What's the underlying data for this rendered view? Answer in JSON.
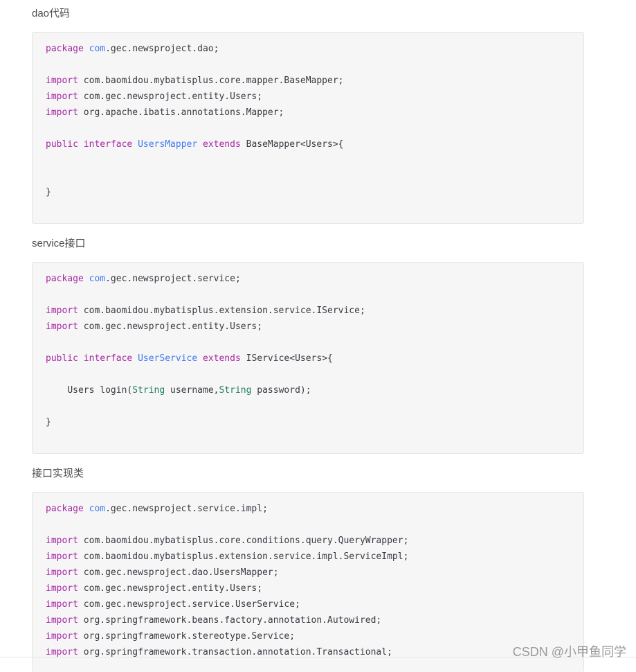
{
  "sections": [
    {
      "title": "dao代码",
      "code": {
        "line1": {
          "kw": "package",
          "pkg": "com",
          "rest": ".gec.newsproject.dao;"
        },
        "line2": {
          "kw": "import",
          "rest": "com.baomidou.mybatisplus.core.mapper.BaseMapper;"
        },
        "line3": {
          "kw": "import",
          "rest": "com.gec.newsproject.entity.Users;"
        },
        "line4": {
          "kw": "import",
          "rest": "org.apache.ibatis.annotations.Mapper;"
        },
        "line5": {
          "kw1": "public",
          "kw2": "interface",
          "name": "UsersMapper",
          "kw3": "extends",
          "rest": "BaseMapper<Users>{"
        },
        "line6": {
          "rest": "}"
        }
      }
    },
    {
      "title": "service接口",
      "code": {
        "line1": {
          "kw": "package",
          "pkg": "com",
          "rest": ".gec.newsproject.service;"
        },
        "line2": {
          "kw": "import",
          "rest": "com.baomidou.mybatisplus.extension.service.IService;"
        },
        "line3": {
          "kw": "import",
          "rest": "com.gec.newsproject.entity.Users;"
        },
        "line4": {
          "kw1": "public",
          "kw2": "interface",
          "name": "UserService",
          "kw3": "extends",
          "rest": "IService<Users>{"
        },
        "line5": {
          "a": "Users login(",
          "t1": "String",
          "b": " username,",
          "t2": "String",
          "c": " password);"
        },
        "line6": {
          "rest": "}"
        }
      }
    },
    {
      "title": "接口实现类",
      "code": {
        "line1": {
          "kw": "package",
          "pkg": "com",
          "rest": ".gec.newsproject.service.impl;"
        },
        "imports": [
          "com.baomidou.mybatisplus.core.conditions.query.QueryWrapper;",
          "com.baomidou.mybatisplus.extension.service.impl.ServiceImpl;",
          "com.gec.newsproject.dao.UsersMapper;",
          "com.gec.newsproject.entity.Users;",
          "com.gec.newsproject.service.UserService;",
          "org.springframework.beans.factory.annotation.Autowired;",
          "org.springframework.stereotype.Service;",
          "org.springframework.transaction.annotation.Transactional;"
        ],
        "import_kw": "import"
      }
    }
  ],
  "watermark": "CSDN @小甲鱼同学"
}
